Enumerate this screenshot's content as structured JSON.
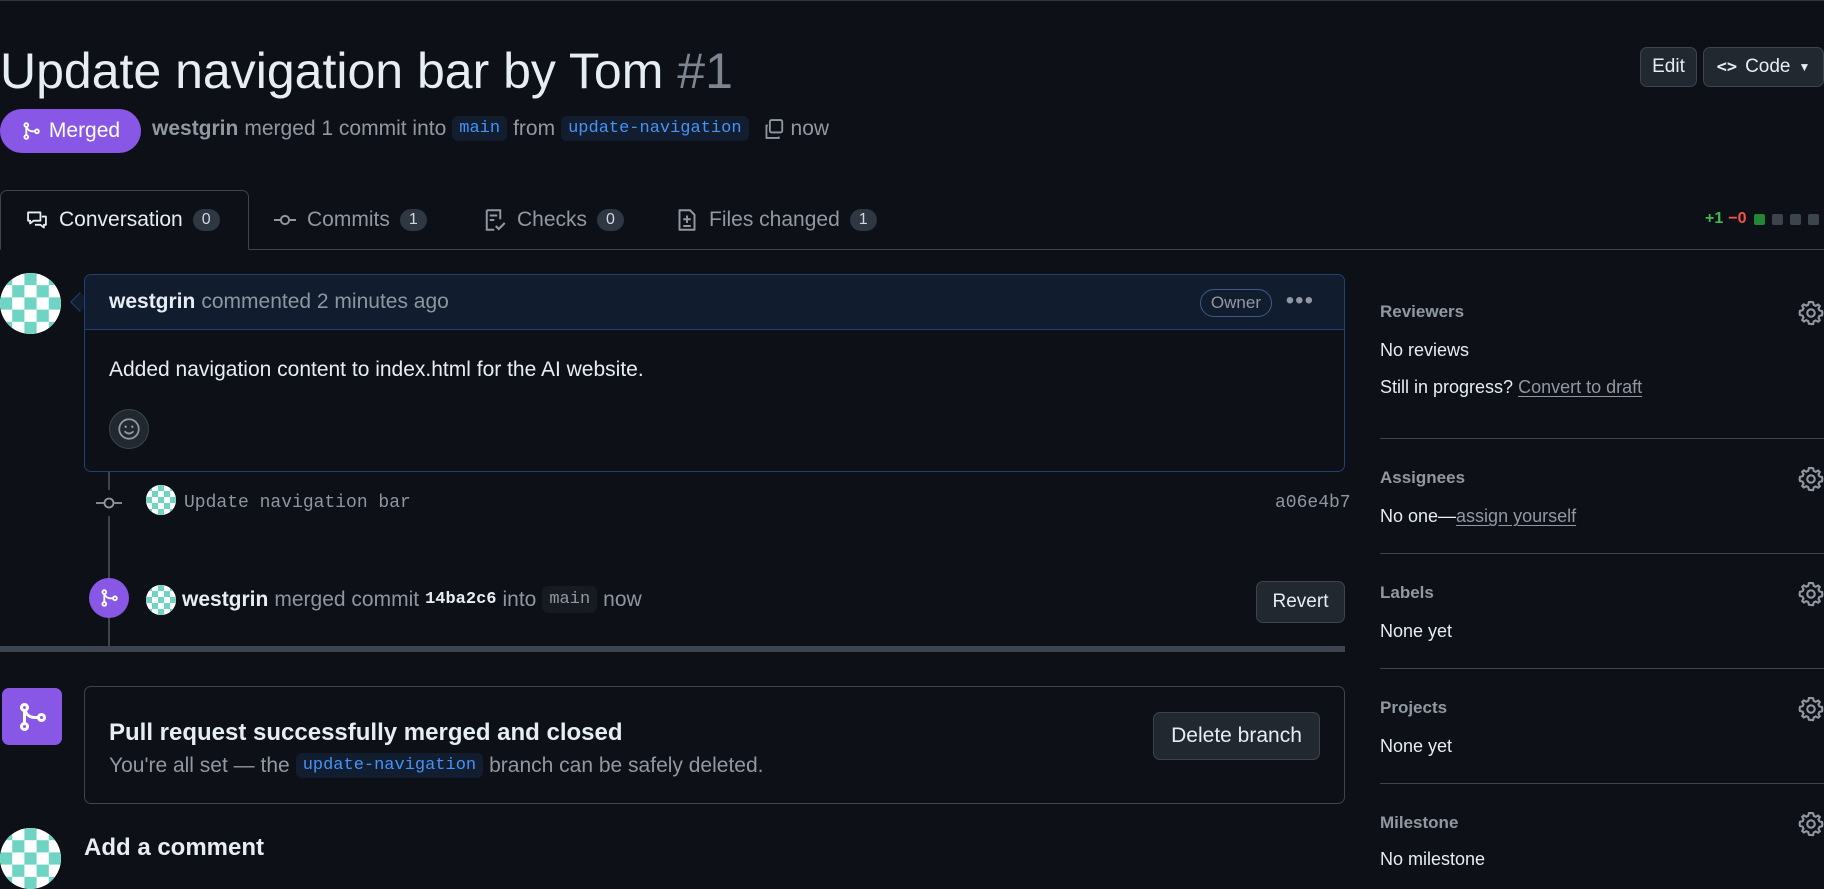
{
  "header": {
    "title": "Update navigation bar by Tom",
    "number": "#1",
    "edit_label": "Edit",
    "code_label": "Code"
  },
  "status": {
    "state_label": "Merged",
    "author": "westgrin",
    "merged_text": "merged 1 commit into",
    "base_branch": "main",
    "from_text": "from",
    "head_branch": "update-navigation",
    "time": "now"
  },
  "tabs": [
    {
      "label": "Conversation",
      "count": "0"
    },
    {
      "label": "Commits",
      "count": "1"
    },
    {
      "label": "Checks",
      "count": "0"
    },
    {
      "label": "Files changed",
      "count": "1"
    }
  ],
  "diffstat": {
    "additions": "+1",
    "deletions": "−0"
  },
  "comment": {
    "author": "westgrin",
    "action": "commented 2 minutes ago",
    "role": "Owner",
    "body": "Added navigation content to index.html for the AI website."
  },
  "commit": {
    "message": "Update navigation bar",
    "sha": "a06e4b7"
  },
  "merge_event": {
    "author": "westgrin",
    "text": "merged commit",
    "sha": "14ba2c6",
    "into": "into",
    "branch": "main",
    "time": "now",
    "revert_label": "Revert"
  },
  "merged_box": {
    "heading": "Pull request successfully merged and closed",
    "prefix": "You're all set — the",
    "branch": "update-navigation",
    "suffix": "branch can be safely deleted.",
    "delete_label": "Delete branch"
  },
  "add_comment": "Add a comment",
  "sidebar": {
    "reviewers": {
      "title": "Reviewers",
      "value": "No reviews",
      "progress_text": "Still in progress?",
      "progress_link": "Convert to draft"
    },
    "assignees": {
      "title": "Assignees",
      "value": "No one—",
      "link": "assign yourself"
    },
    "labels": {
      "title": "Labels",
      "value": "None yet"
    },
    "projects": {
      "title": "Projects",
      "value": "None yet"
    },
    "milestone": {
      "title": "Milestone",
      "value": "No milestone"
    }
  },
  "colors": {
    "merged": "#8957e5",
    "link": "#4493f8",
    "background": "#0d1117"
  }
}
